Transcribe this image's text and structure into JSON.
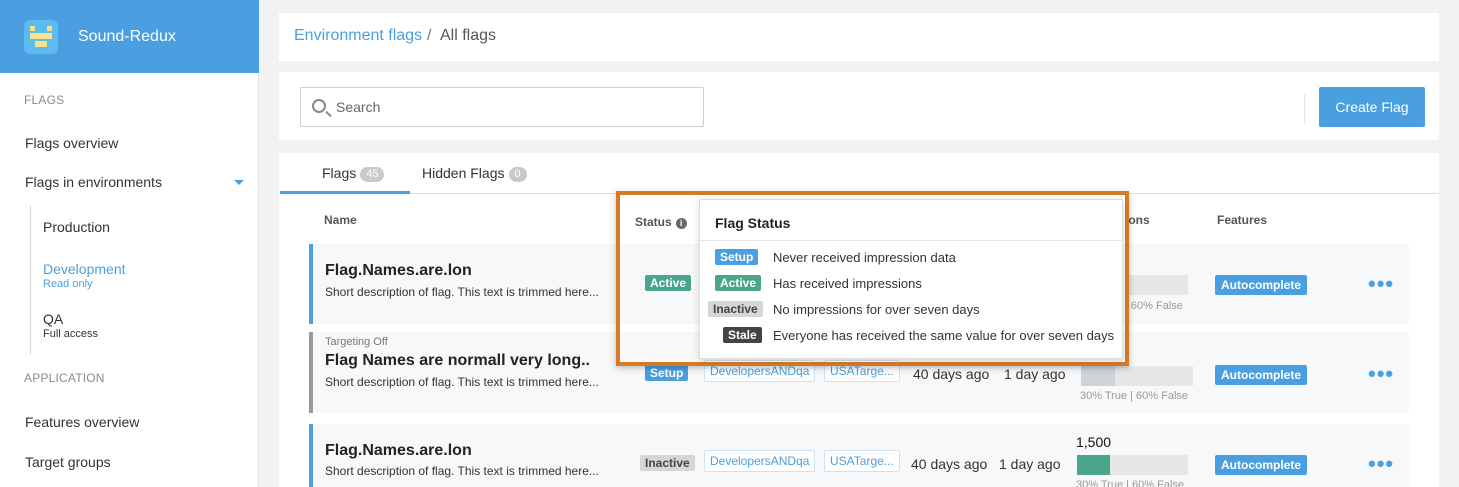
{
  "app": {
    "name": "Sound-Redux"
  },
  "sidebar": {
    "flags_section": "FLAGS",
    "flags_overview": "Flags overview",
    "flags_in_environments": "Flags in environments",
    "environments": [
      {
        "name": "Production",
        "sub": ""
      },
      {
        "name": "Development",
        "sub": "Read only"
      },
      {
        "name": "QA",
        "sub": "Full access"
      }
    ],
    "application_section": "APPLICATION",
    "features_overview": "Features overview",
    "target_groups": "Target groups"
  },
  "breadcrumb": {
    "link": "Environment flags",
    "separator": "/",
    "current": "All flags"
  },
  "toolbar": {
    "search_placeholder": "Search",
    "create_label": "Create Flag"
  },
  "tabs": [
    {
      "label": "Flags",
      "count": "45"
    },
    {
      "label": "Hidden Flags",
      "count": "0"
    }
  ],
  "columns": {
    "name": "Name",
    "status": "Status",
    "impressions": "ions",
    "features": "Features"
  },
  "rows": [
    {
      "targeting": "",
      "title": "Flag.Names.are.long",
      "description": "Short description of flag. This text is trimmed here...",
      "status": "Active",
      "segments": [],
      "created": "",
      "modified": "",
      "impressions": "",
      "true_fraction": 0,
      "caption": "| 60% False",
      "feature": "Autocomplete",
      "more": "•••"
    },
    {
      "targeting": "Targeting Off",
      "title": "Flag Names are normall very long..",
      "description": "Short description of flag. This text is trimmed here...",
      "status": "Setup",
      "segments": [
        "DevelopersANDqa",
        "USATarge..."
      ],
      "created": "40 days ago",
      "modified": "1 day ago",
      "impressions": "",
      "true_fraction": 0.3,
      "caption": "30% True | 60% False",
      "feature": "Autocomplete",
      "more": "•••"
    },
    {
      "targeting": "",
      "title": "Flag.Names.are.long",
      "description": "Short description of flag. This text is trimmed here...",
      "status": "Inactive",
      "segments": [
        "DevelopersANDqa",
        "USATarge..."
      ],
      "created": "40 days ago",
      "modified": "1 day ago",
      "impressions": "1,500",
      "true_fraction": 0.3,
      "caption": "30% True | 60% False",
      "feature": "Autocomplete",
      "more": "•••"
    }
  ],
  "tooltip": {
    "title": "Flag Status",
    "items": [
      {
        "badge": "Setup",
        "text": "Never received impression data"
      },
      {
        "badge": "Active",
        "text": "Has received impressions"
      },
      {
        "badge": "Inactive",
        "text": "No impressions for over seven days"
      },
      {
        "badge": "Stale",
        "text": "Everyone has received the same value for over seven days"
      }
    ]
  },
  "colors": {
    "accent": "#4a9fe0",
    "active": "#4aa68a",
    "highlight_frame": "#d77a26"
  }
}
